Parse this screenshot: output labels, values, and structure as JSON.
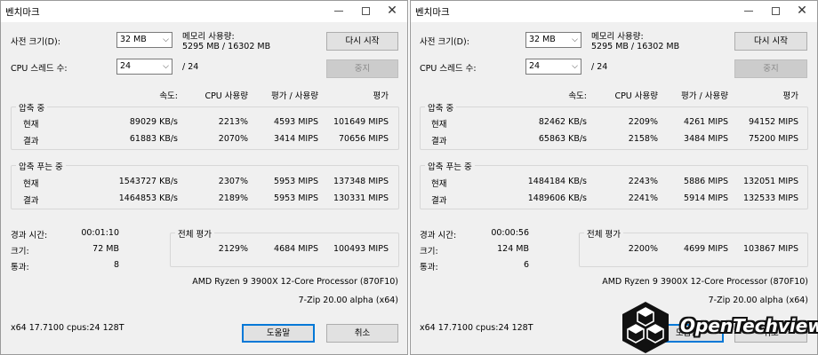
{
  "windows": [
    {
      "title": "벤치마크",
      "dict_label": "사전 크기(D):",
      "dict_value": "32 MB",
      "mem_label": "메모리 사용량:",
      "mem_value": "5295 MB / 16302 MB",
      "restart_label": "다시 시작",
      "threads_label": "CPU 스레드 수:",
      "threads_value": "24",
      "threads_total": "/ 24",
      "stop_label": "중지",
      "headers": {
        "speed": "속도:",
        "cpu": "CPU 사용량",
        "rating_usage": "평가 / 사용량",
        "rating": "평가"
      },
      "compress": {
        "title": "압축 중",
        "current": {
          "label": "현재",
          "speed": "89029 KB/s",
          "cpu": "2213%",
          "rating_usage": "4593 MIPS",
          "rating": "101649 MIPS"
        },
        "result": {
          "label": "결과",
          "speed": "61883 KB/s",
          "cpu": "2070%",
          "rating_usage": "3414 MIPS",
          "rating": "70656 MIPS"
        }
      },
      "decompress": {
        "title": "압축 푸는 중",
        "current": {
          "label": "현재",
          "speed": "1543727 KB/s",
          "cpu": "2307%",
          "rating_usage": "5953 MIPS",
          "rating": "137348 MIPS"
        },
        "result": {
          "label": "결과",
          "speed": "1464853 KB/s",
          "cpu": "2189%",
          "rating_usage": "5953 MIPS",
          "rating": "130331 MIPS"
        }
      },
      "elapsed_label": "경과 시간:",
      "elapsed_value": "00:01:10",
      "size_label": "크기:",
      "size_value": "72 MB",
      "passes_label": "통과:",
      "passes_value": "8",
      "total": {
        "title": "전체 평가",
        "cpu": "2129%",
        "rating_usage": "4684 MIPS",
        "rating": "100493 MIPS"
      },
      "cpu_name": "AMD Ryzen 9 3900X 12-Core Processor (870F10)",
      "zip_version": "7-Zip 20.00 alpha (x64)",
      "sys_info": "x64 17.7100 cpus:24 128T",
      "help_label": "도움말",
      "cancel_label": "취소"
    },
    {
      "title": "벤치마크",
      "dict_label": "사전 크기(D):",
      "dict_value": "32 MB",
      "mem_label": "메모리 사용량:",
      "mem_value": "5295 MB / 16302 MB",
      "restart_label": "다시 시작",
      "threads_label": "CPU 스레드 수:",
      "threads_value": "24",
      "threads_total": "/ 24",
      "stop_label": "중지",
      "headers": {
        "speed": "속도:",
        "cpu": "CPU 사용량",
        "rating_usage": "평가 / 사용량",
        "rating": "평가"
      },
      "compress": {
        "title": "압축 중",
        "current": {
          "label": "현재",
          "speed": "82462 KB/s",
          "cpu": "2209%",
          "rating_usage": "4261 MIPS",
          "rating": "94152 MIPS"
        },
        "result": {
          "label": "결과",
          "speed": "65863 KB/s",
          "cpu": "2158%",
          "rating_usage": "3484 MIPS",
          "rating": "75200 MIPS"
        }
      },
      "decompress": {
        "title": "압축 푸는 중",
        "current": {
          "label": "현재",
          "speed": "1484184 KB/s",
          "cpu": "2243%",
          "rating_usage": "5886 MIPS",
          "rating": "132051 MIPS"
        },
        "result": {
          "label": "결과",
          "speed": "1489606 KB/s",
          "cpu": "2241%",
          "rating_usage": "5914 MIPS",
          "rating": "132533 MIPS"
        }
      },
      "elapsed_label": "경과 시간:",
      "elapsed_value": "00:00:56",
      "size_label": "크기:",
      "size_value": "124 MB",
      "passes_label": "통과:",
      "passes_value": "6",
      "total": {
        "title": "전체 평가",
        "cpu": "2200%",
        "rating_usage": "4699 MIPS",
        "rating": "103867 MIPS"
      },
      "cpu_name": "AMD Ryzen 9 3900X 12-Core Processor (870F10)",
      "zip_version": "7-Zip 20.00 alpha (x64)",
      "sys_info": "x64 17.7100 cpus:24 128T",
      "help_label": "도움말",
      "cancel_label": "취소"
    }
  ],
  "watermark": {
    "text": "OpenTechview",
    "icon": "hexagon-cubes-logo"
  }
}
